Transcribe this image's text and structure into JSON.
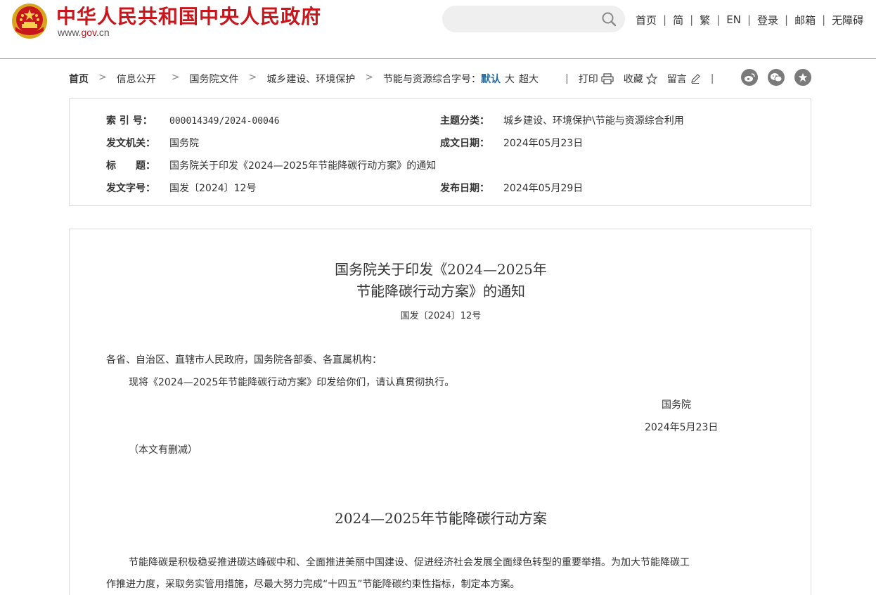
{
  "header": {
    "title": "中华人民共和国中央人民政府",
    "url_prefix": "www.",
    "url_gov": "gov",
    "url_suffix": ".cn",
    "icons": {
      "emblem": "national-emblem-icon",
      "search": "search-icon"
    },
    "colors": {
      "brand": "#c8161d",
      "accent": "#1d6aa5"
    },
    "nav": [
      "首页",
      "简",
      "繁",
      "EN",
      "登录",
      "邮箱",
      "无障碍"
    ]
  },
  "breadcrumb": {
    "items": [
      "首页",
      "信息公开",
      "国务院文件",
      "城乡建设、环境保护",
      "节能与资源综合利用"
    ],
    "fontsize_label": "字号：",
    "fontsize_options": [
      "默认",
      "大",
      "超大"
    ],
    "tools": {
      "print": "打印",
      "favorite": "收藏",
      "comment": "留言"
    },
    "share_icons": [
      "weibo-icon",
      "wechat-icon",
      "star-icon"
    ]
  },
  "info": {
    "index_label": "索 引 号：",
    "index_value": "000014349/2024-00046",
    "topic_label": "主题分类：",
    "topic_value": "城乡建设、环境保护\\节能与资源综合利用",
    "issuer_label": "发文机关：",
    "issuer_value": "国务院",
    "written_label": "成文日期：",
    "written_value": "2024年05月23日",
    "title_label": "标　　题：",
    "title_value": "国务院关于印发《2024—2025年节能降碳行动方案》的通知",
    "docno_label": "发文字号：",
    "docno_value": "国发〔2024〕12号",
    "published_label": "发布日期：",
    "published_value": "2024年05月29日"
  },
  "article": {
    "title_line1": "国务院关于印发《2024—2025年",
    "title_line2": "节能降碳行动方案》的通知",
    "doc_number": "国发〔2024〕12号",
    "salutation": "各省、自治区、直辖市人民政府，国务院各部委、各直属机构：",
    "body": "现将《2024—2025年节能降碳行动方案》印发给你们，请认真贯彻执行。",
    "signature": "国务院",
    "date": "2024年5月23日",
    "note": "（本文有删减）",
    "plan_title": "2024—2025年节能降碳行动方案",
    "intro_line1": "节能降碳是积极稳妥推进碳达峰碳中和、全面推进美丽中国建设、促进经济社会发展全面绿色转型的重要举措。为加大节能降碳工",
    "intro_line2": "作推进力度，采取务实管用措施，尽最大努力完成“十四五”节能降碳约束性指标，制定本方案。"
  }
}
